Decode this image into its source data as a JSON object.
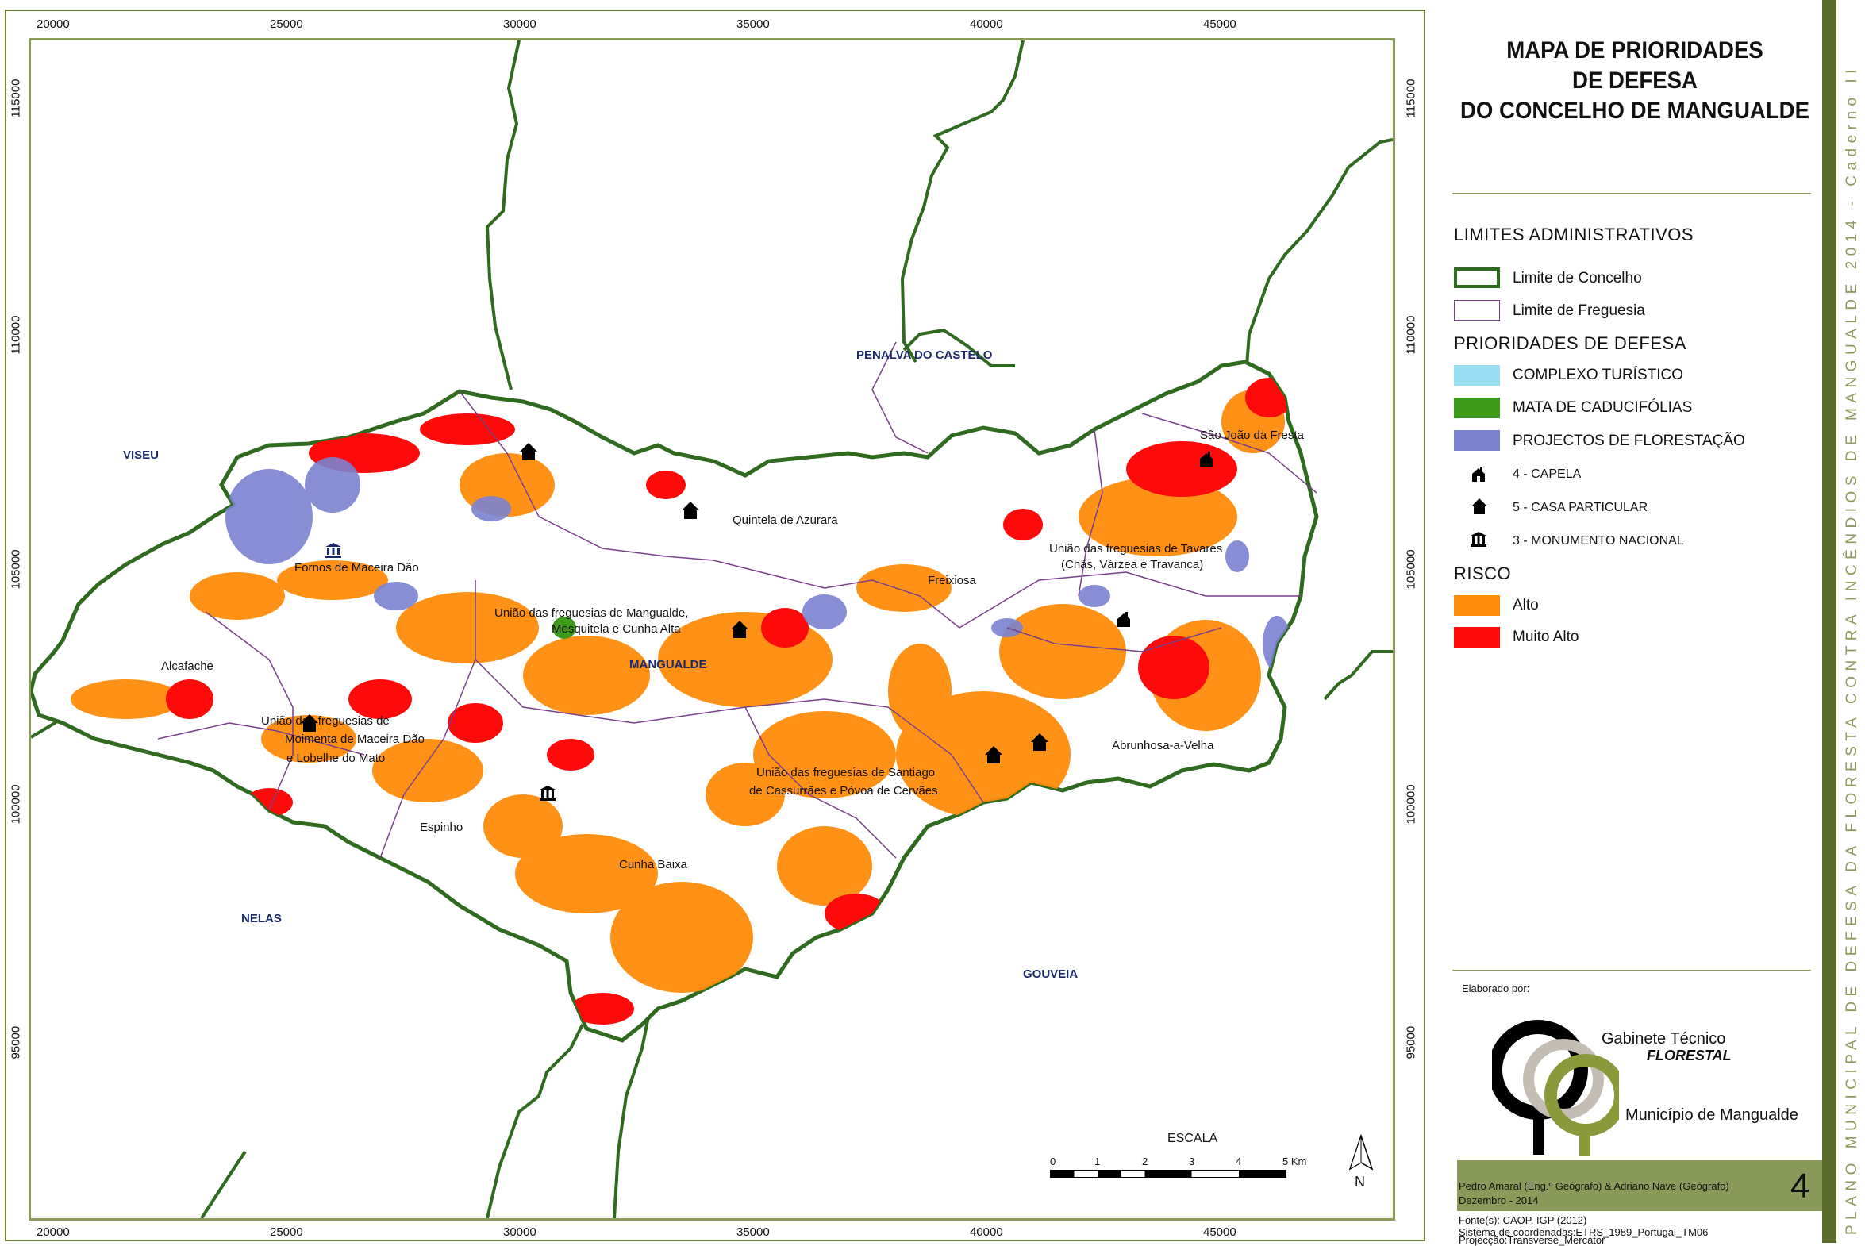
{
  "title": {
    "line1": "MAPA DE PRIORIDADES",
    "line2": "DE DEFESA",
    "line3": "DO CONCELHO DE MANGUALDE"
  },
  "axis": {
    "x_ticks": [
      "20000",
      "25000",
      "30000",
      "35000",
      "40000",
      "45000"
    ],
    "y_ticks": [
      "115000",
      "110000",
      "105000",
      "100000",
      "95000"
    ]
  },
  "regions": {
    "viseu": "VISEU",
    "penalva": "PENALVA DO CASTELO",
    "nelas": "NELAS",
    "gouveia": "GOUVEIA",
    "mangualde": "MANGUALDE"
  },
  "places": {
    "fornos": "Fornos de Maceira Dão",
    "uniao_mangualde_1": "União das freguesias de Mangualde,",
    "uniao_mangualde_2": "Mesquitela e Cunha Alta",
    "quintela": "Quintela de Azurara",
    "freixiosa": "Freixiosa",
    "uniao_tavares_1": "União das freguesias de Tavares",
    "uniao_tavares_2": "(Chãs, Várzea e Travanca)",
    "sao_joao": "São João da Fresta",
    "alcafache": "Alcafache",
    "uniao_moimenta_1": "União das freguesias de",
    "uniao_moimenta_2": "Moimenta de Maceira Dão",
    "uniao_moimenta_3": "e Lobelhe do Mato",
    "abrunhosa": "Abrunhosa-a-Velha",
    "uniao_santiago_1": "União das freguesias de Santiago",
    "uniao_santiago_2": "de Cassurrães e Póvoa de Cervães",
    "espinho": "Espinho",
    "cunha_baixa": "Cunha Baixa"
  },
  "legend": {
    "admin_header": "LIMITES ADMINISTRATIVOS",
    "limite_concelho": "Limite de Concelho",
    "limite_freguesia": "Limite de Freguesia",
    "prioridades_header": "PRIORIDADES DE DEFESA",
    "complexo": "COMPLEXO TURÍSTICO",
    "mata": "MATA DE CADUCIFÓLIAS",
    "projectos": "PROJECTOS DE FLORESTAÇÃO",
    "capela": "4 - CAPELA",
    "casa": "5 - CASA PARTICULAR",
    "monumento": "3 - MONUMENTO NACIONAL",
    "risco_header": "RISCO",
    "alto": "Alto",
    "muito_alto": "Muito Alto"
  },
  "colors": {
    "concelho": "#2e6b1e",
    "freguesia": "#7a3f8a",
    "complexo": "#99ddf0",
    "mata": "#3d9a1a",
    "projectos": "#7a82d0",
    "alto": "#ff8c0a",
    "muito_alto": "#ff0a0a",
    "accent": "#8a9a5b"
  },
  "scale": {
    "title": "ESCALA",
    "labels": [
      "0",
      "1",
      "2",
      "3",
      "4",
      "5 Km"
    ],
    "north": "N"
  },
  "credits": {
    "elaborado": "Elaborado por:",
    "gabinete_1": "Gabinete Técnico",
    "gabinete_2": "FLORESTAL",
    "municipio": "Município de Mangualde",
    "authors": "Pedro Amaral (Eng.º Geógrafo) & Adriano Nave (Geógrafo)",
    "date": "Dezembro - 2014",
    "map_number": "4",
    "fonte": "Fonte(s): CAOP, IGP (2012)",
    "sistema": "Sistema de coordenadas:ETRS_1989_Portugal_TM06",
    "projeccao": "Projecção:Transverse_Mercator"
  },
  "side_text": "PLANO MUNICIPAL DE DEFESA DA FLORESTA CONTRA INCÊNDIOS DE MANGUALDE 2014 - Caderno II"
}
